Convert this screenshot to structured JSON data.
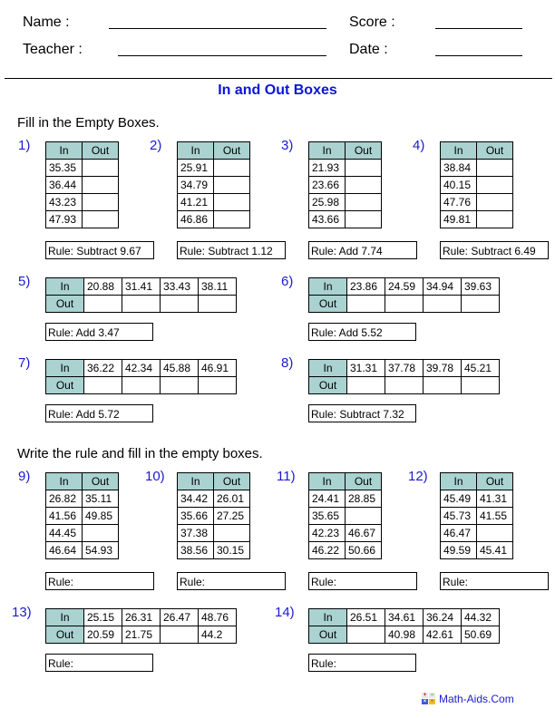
{
  "header": {
    "name_label": "Name :",
    "teacher_label": "Teacher :",
    "score_label": "Score :",
    "date_label": "Date :"
  },
  "title": "In and Out Boxes",
  "section1": {
    "instruction": "Fill in the Empty Boxes."
  },
  "section2": {
    "instruction": "Write the rule and fill in the empty boxes."
  },
  "labels": {
    "in": "In",
    "out": "Out"
  },
  "problems": [
    {
      "num": "1)",
      "in": [
        "35.35",
        "36.44",
        "43.23",
        "47.93"
      ],
      "out": [
        "",
        "",
        "",
        ""
      ],
      "rule": "Rule: Subtract 9.67"
    },
    {
      "num": "2)",
      "in": [
        "25.91",
        "34.79",
        "41.21",
        "46.86"
      ],
      "out": [
        "",
        "",
        "",
        ""
      ],
      "rule": "Rule: Subtract 1.12"
    },
    {
      "num": "3)",
      "in": [
        "21.93",
        "23.66",
        "25.98",
        "43.66"
      ],
      "out": [
        "",
        "",
        "",
        ""
      ],
      "rule": "Rule: Add 7.74"
    },
    {
      "num": "4)",
      "in": [
        "38.84",
        "40.15",
        "47.76",
        "49.81"
      ],
      "out": [
        "",
        "",
        "",
        ""
      ],
      "rule": "Rule: Subtract 6.49"
    },
    {
      "num": "5)",
      "in": [
        "20.88",
        "31.41",
        "33.43",
        "38.11"
      ],
      "out": [
        "",
        "",
        "",
        ""
      ],
      "rule": "Rule: Add 3.47"
    },
    {
      "num": "6)",
      "in": [
        "23.86",
        "24.59",
        "34.94",
        "39.63"
      ],
      "out": [
        "",
        "",
        "",
        ""
      ],
      "rule": "Rule: Add 5.52"
    },
    {
      "num": "7)",
      "in": [
        "36.22",
        "42.34",
        "45.88",
        "46.91"
      ],
      "out": [
        "",
        "",
        "",
        ""
      ],
      "rule": "Rule: Add 5.72"
    },
    {
      "num": "8)",
      "in": [
        "31.31",
        "37.78",
        "39.78",
        "45.21"
      ],
      "out": [
        "",
        "",
        "",
        ""
      ],
      "rule": "Rule: Subtract 7.32"
    },
    {
      "num": "9)",
      "in": [
        "26.82",
        "41.56",
        "44.45",
        "46.64"
      ],
      "out": [
        "35.11",
        "49.85",
        "",
        "54.93"
      ],
      "rule": "Rule:"
    },
    {
      "num": "10)",
      "in": [
        "34.42",
        "35.66",
        "37.38",
        "38.56"
      ],
      "out": [
        "26.01",
        "27.25",
        "",
        "30.15"
      ],
      "rule": "Rule:"
    },
    {
      "num": "11)",
      "in": [
        "24.41",
        "35.65",
        "42.23",
        "46.22"
      ],
      "out": [
        "28.85",
        "",
        "46.67",
        "50.66"
      ],
      "rule": "Rule:"
    },
    {
      "num": "12)",
      "in": [
        "45.49",
        "45.73",
        "46.47",
        "49.59"
      ],
      "out": [
        "41.31",
        "41.55",
        "",
        "45.41"
      ],
      "rule": "Rule:"
    },
    {
      "num": "13)",
      "in": [
        "25.15",
        "26.31",
        "26.47",
        "48.76"
      ],
      "out": [
        "20.59",
        "21.75",
        "",
        "44.2"
      ],
      "rule": "Rule:"
    },
    {
      "num": "14)",
      "in": [
        "26.51",
        "34.61",
        "36.24",
        "44.32"
      ],
      "out": [
        "",
        "40.98",
        "42.61",
        "50.69"
      ],
      "rule": "Rule:"
    }
  ],
  "footer": {
    "brand": "Math-Aids.Com",
    "logo_glyphs": [
      "+",
      "−",
      "×",
      "÷"
    ]
  }
}
